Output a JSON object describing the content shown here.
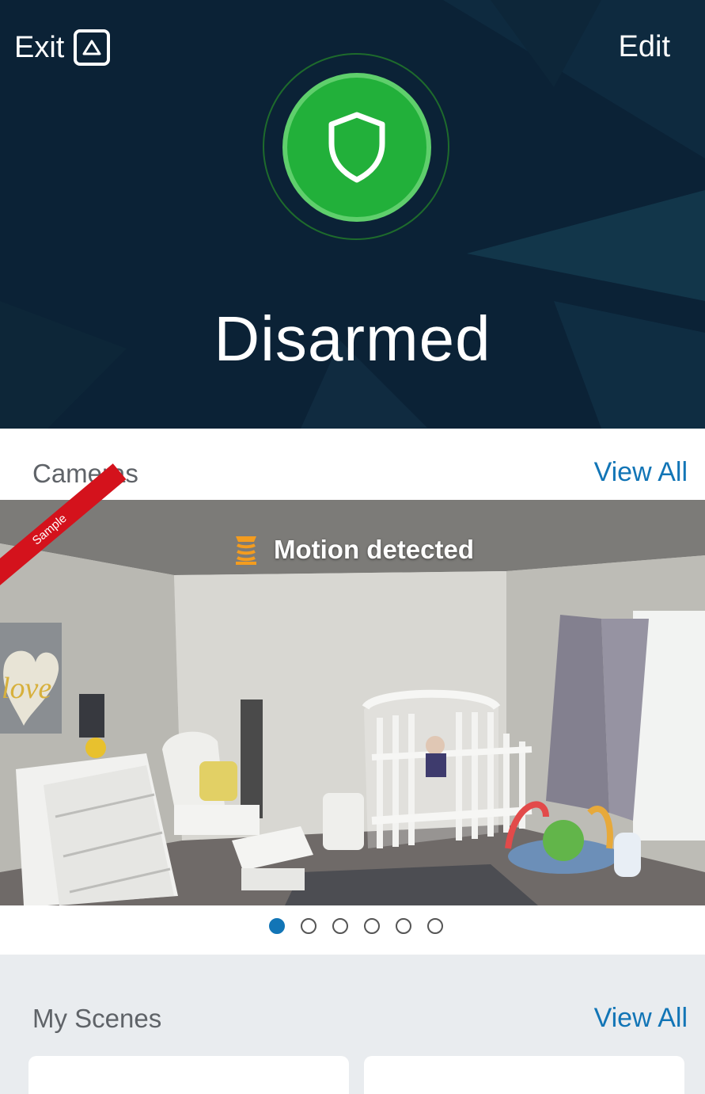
{
  "header": {
    "exit_label": "Exit",
    "exit_icon": "alarm-triangle-icon",
    "edit_label": "Edit"
  },
  "security": {
    "status": "Disarmed",
    "icon": "shield-icon",
    "accent_color": "#22b03a"
  },
  "cameras": {
    "title": "Cameras",
    "view_all_label": "View All",
    "feed": {
      "badge": "Sample",
      "motion_text": "Motion detected",
      "motion_icon": "motion-sensor-icon"
    },
    "pager": {
      "total": 6,
      "active_index": 0
    }
  },
  "scenes": {
    "title": "My Scenes",
    "view_all_label": "View All"
  },
  "colors": {
    "link": "#1275b6",
    "hero_bg": "#0b2236",
    "alert_red": "#d4121c",
    "motion_orange": "#f39c1f"
  }
}
